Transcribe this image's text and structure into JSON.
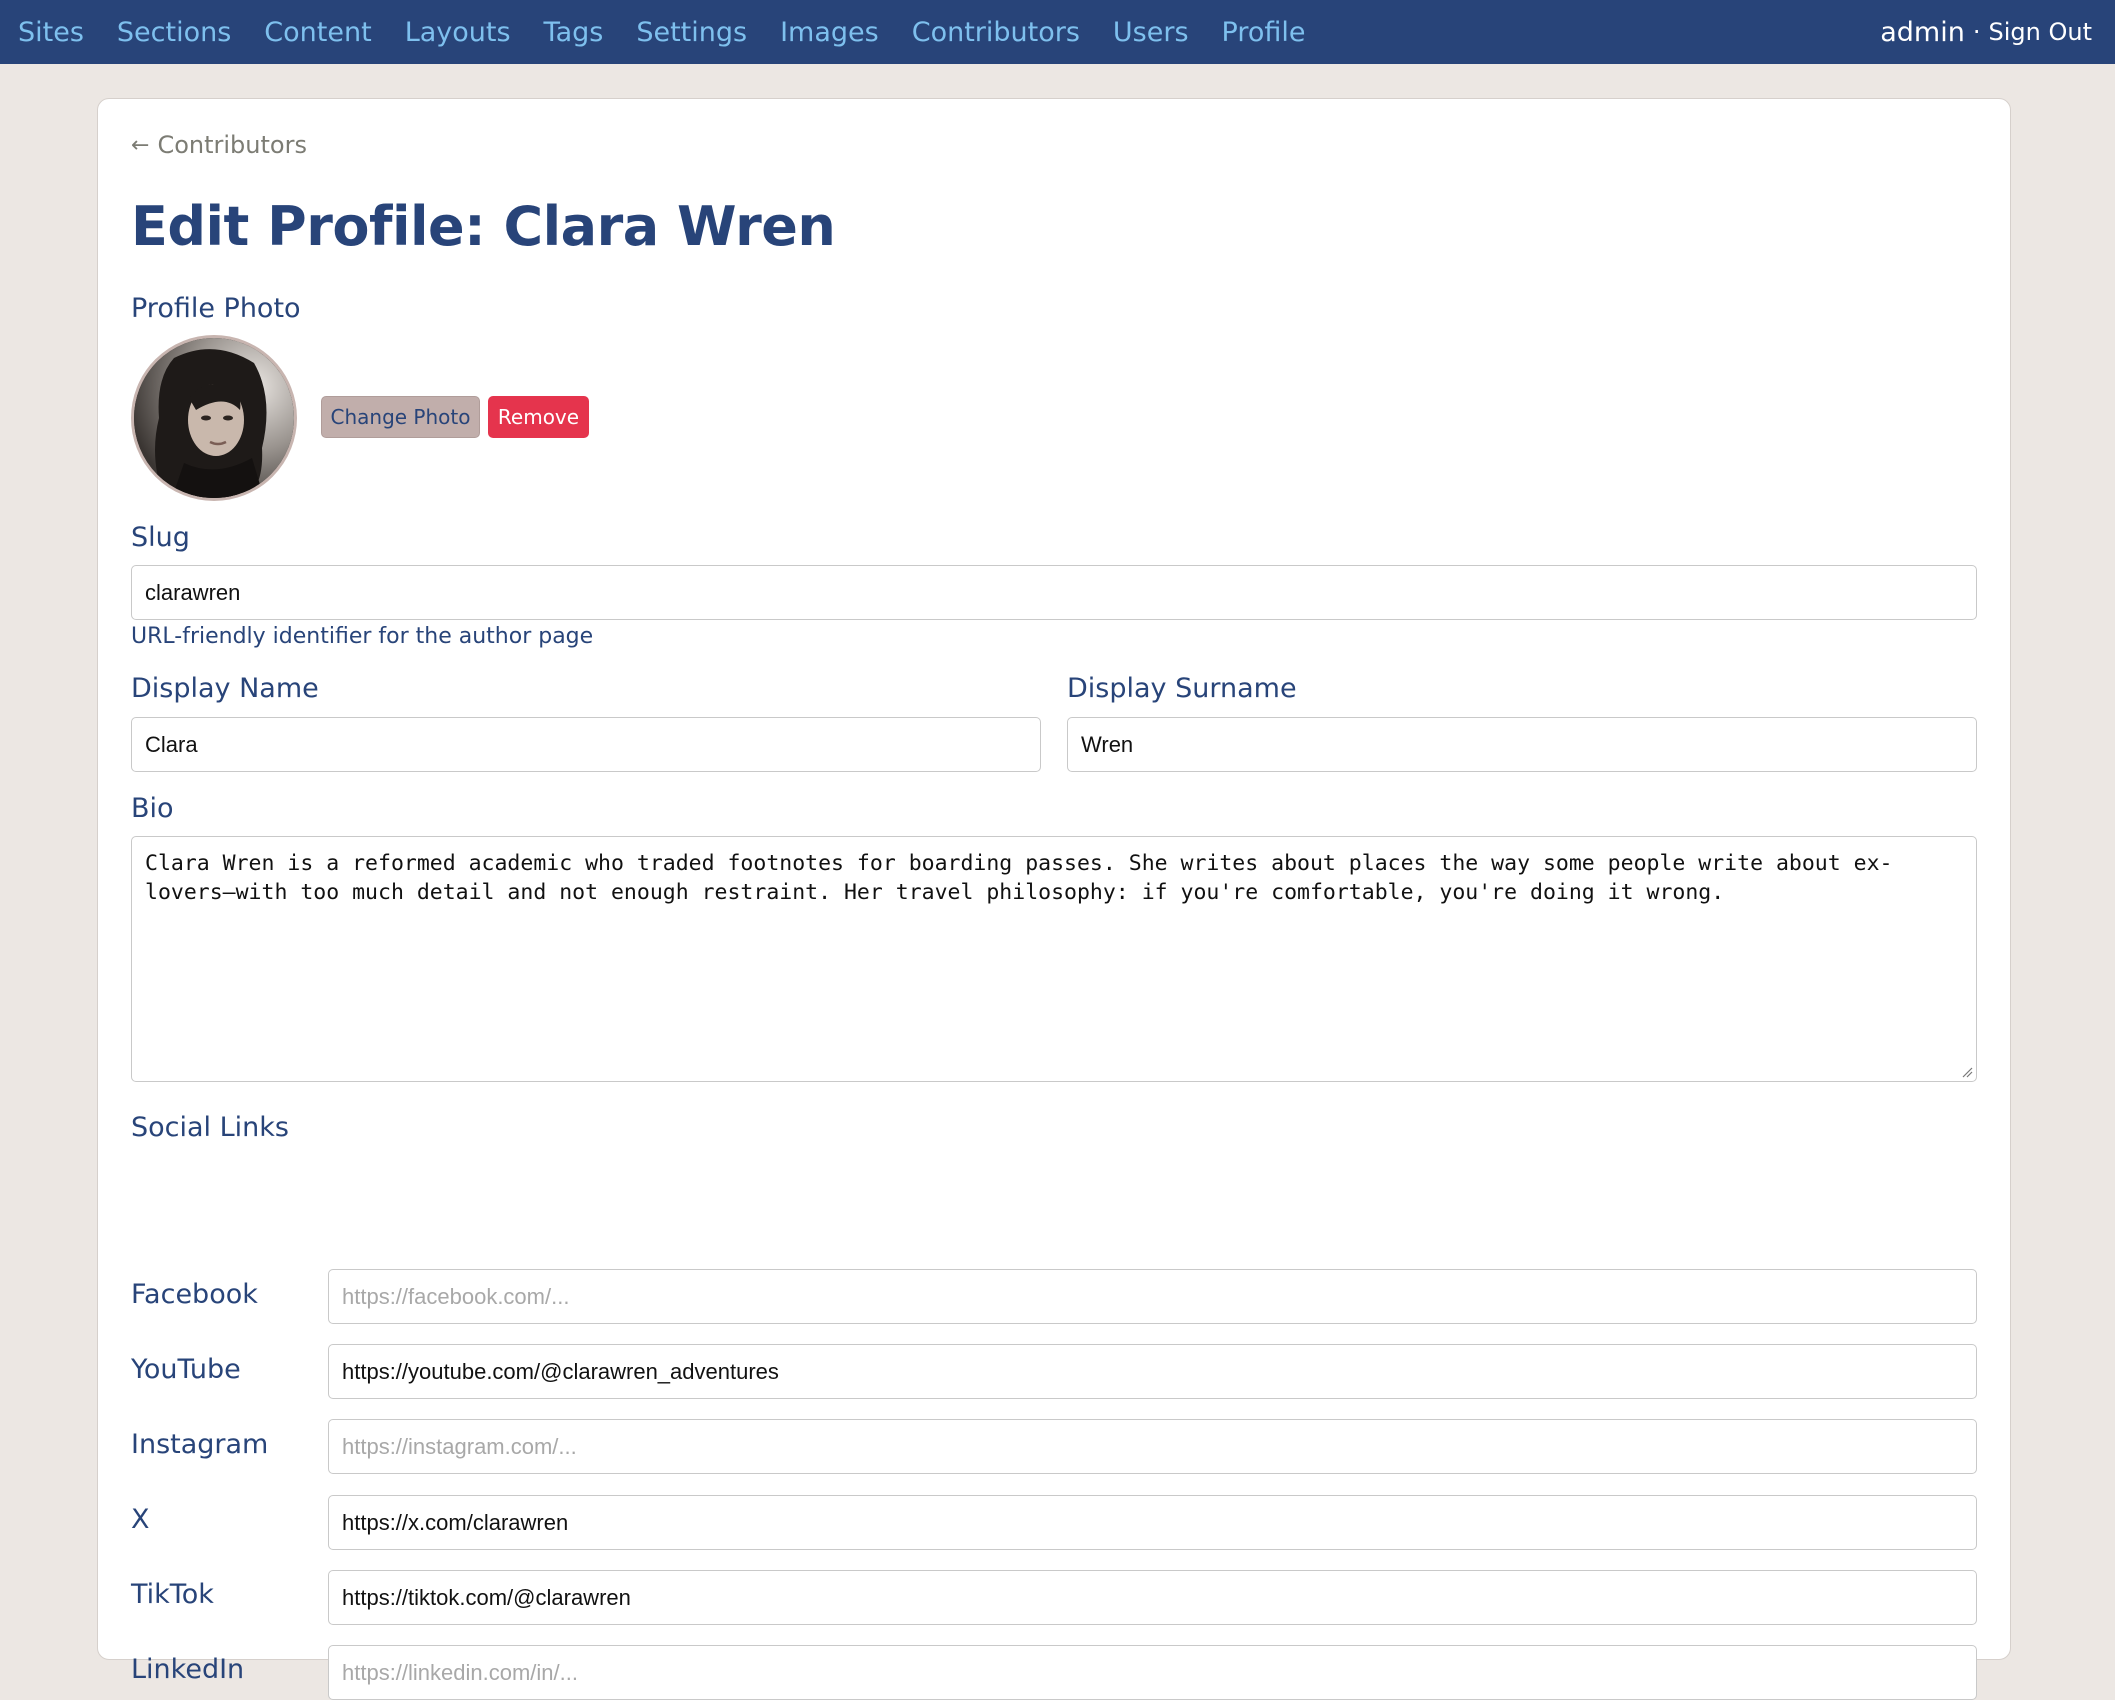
{
  "colors": {
    "nav_bg": "#284479",
    "nav_link": "#7ec0ee",
    "accent": "#284479",
    "danger": "#e5344d",
    "page_bg": "#ece7e3"
  },
  "nav": {
    "items": [
      "Sites",
      "Sections",
      "Content",
      "Layouts",
      "Tags",
      "Settings",
      "Images",
      "Contributors",
      "Users",
      "Profile"
    ],
    "user": "admin",
    "separator": "·",
    "sign_out": "Sign Out"
  },
  "back": {
    "arrow": "←",
    "label": "Contributors"
  },
  "page_title": "Edit Profile: Clara Wren",
  "photo": {
    "label": "Profile Photo",
    "change_label": "Change Photo",
    "remove_label": "Remove"
  },
  "slug": {
    "label": "Slug",
    "value": "clarawren",
    "help": "URL-friendly identifier for the author page"
  },
  "display_name": {
    "label": "Display Name",
    "value": "Clara"
  },
  "display_surname": {
    "label": "Display Surname",
    "value": "Wren"
  },
  "bio": {
    "label": "Bio",
    "line1": "Clara Wren is a reformed academic who traded footnotes for boarding passes. She writes about places the way some people write about ex-",
    "line2": "lovers—with too much detail and not enough restraint. Her travel philosophy: if you're comfortable, you're doing it wrong."
  },
  "social": {
    "label": "Social Links",
    "links": [
      {
        "name": "Facebook",
        "value": "",
        "placeholder": "https://facebook.com/..."
      },
      {
        "name": "YouTube",
        "value": "https://youtube.com/@clarawren_adventures",
        "placeholder": ""
      },
      {
        "name": "Instagram",
        "value": "",
        "placeholder": "https://instagram.com/..."
      },
      {
        "name": "X",
        "value": "https://x.com/clarawren",
        "placeholder": ""
      },
      {
        "name": "TikTok",
        "value": "https://tiktok.com/@clarawren",
        "placeholder": ""
      },
      {
        "name": "LinkedIn",
        "value": "",
        "placeholder": "https://linkedin.com/in/..."
      }
    ]
  }
}
